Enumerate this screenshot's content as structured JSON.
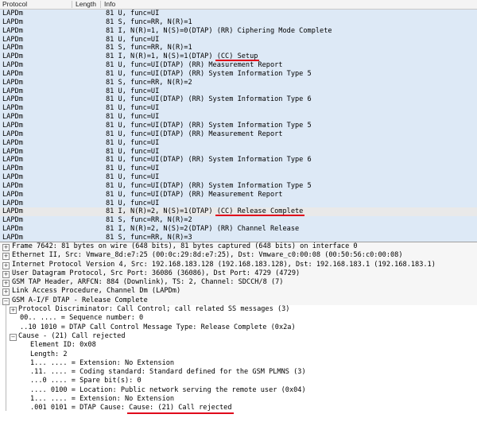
{
  "packet_list": {
    "headers": [
      "Protocol",
      "Length",
      "Info"
    ],
    "rows": [
      {
        "protocol": "LAPDm",
        "length": "",
        "info": "81 U, func=UI"
      },
      {
        "protocol": "LAPDm",
        "length": "",
        "info": "81 S, func=RR, N(R)=1"
      },
      {
        "protocol": "LAPDm",
        "length": "",
        "info": "81 I, N(R)=1, N(S)=0(DTAP) (RR) Ciphering Mode Complete"
      },
      {
        "protocol": "LAPDm",
        "length": "",
        "info": "81 U, func=UI"
      },
      {
        "protocol": "LAPDm",
        "length": "",
        "info": "81 S, func=RR, N(R)=1"
      },
      {
        "protocol": "LAPDm",
        "length": "",
        "info": "81 I, N(R)=1, N(S)=1(DTAP) (CC) Setup"
      },
      {
        "protocol": "LAPDm",
        "length": "",
        "info": "81 U, func=UI(DTAP) (RR) Measurement Report"
      },
      {
        "protocol": "LAPDm",
        "length": "",
        "info": "81 U, func=UI(DTAP) (RR) System Information Type 5"
      },
      {
        "protocol": "LAPDm",
        "length": "",
        "info": "81 S, func=RR, N(R)=2"
      },
      {
        "protocol": "LAPDm",
        "length": "",
        "info": "81 U, func=UI"
      },
      {
        "protocol": "LAPDm",
        "length": "",
        "info": "81 U, func=UI(DTAP) (RR) System Information Type 6"
      },
      {
        "protocol": "LAPDm",
        "length": "",
        "info": "81 U, func=UI"
      },
      {
        "protocol": "LAPDm",
        "length": "",
        "info": "81 U, func=UI"
      },
      {
        "protocol": "LAPDm",
        "length": "",
        "info": "81 U, func=UI(DTAP) (RR) System Information Type 5"
      },
      {
        "protocol": "LAPDm",
        "length": "",
        "info": "81 U, func=UI(DTAP) (RR) Measurement Report"
      },
      {
        "protocol": "LAPDm",
        "length": "",
        "info": "81 U, func=UI"
      },
      {
        "protocol": "LAPDm",
        "length": "",
        "info": "81 U, func=UI"
      },
      {
        "protocol": "LAPDm",
        "length": "",
        "info": "81 U, func=UI(DTAP) (RR) System Information Type 6"
      },
      {
        "protocol": "LAPDm",
        "length": "",
        "info": "81 U, func=UI"
      },
      {
        "protocol": "LAPDm",
        "length": "",
        "info": "81 U, func=UI"
      },
      {
        "protocol": "LAPDm",
        "length": "",
        "info": "81 U, func=UI(DTAP) (RR) System Information Type 5"
      },
      {
        "protocol": "LAPDm",
        "length": "",
        "info": "81 U, func=UI(DTAP) (RR) Measurement Report"
      },
      {
        "protocol": "LAPDm",
        "length": "",
        "info": "81 U, func=UI"
      },
      {
        "protocol": "LAPDm",
        "length": "",
        "info": "81 I, N(R)=2, N(S)=1(DTAP) (CC) Release Complete"
      },
      {
        "protocol": "LAPDm",
        "length": "",
        "info": "81 S, func=RR, N(R)=2"
      },
      {
        "protocol": "LAPDm",
        "length": "",
        "info": "81 I, N(R)=2, N(S)=2(DTAP) (RR) Channel Release"
      },
      {
        "protocol": "LAPDm",
        "length": "",
        "info": "81 S, func=RR, N(R)=3"
      }
    ],
    "selected_row_index": 23
  },
  "details": [
    {
      "level": 0,
      "expander": "+",
      "text": "Frame 7642: 81 bytes on wire (648 bits), 81 bytes captured (648 bits) on interface 0"
    },
    {
      "level": 0,
      "expander": "+",
      "text": "Ethernet II, Src: Vmware_8d:e7:25 (00:0c:29:8d:e7:25), Dst: Vmware_c0:00:08 (00:50:56:c0:00:08)"
    },
    {
      "level": 0,
      "expander": "+",
      "text": "Internet Protocol Version 4, Src: 192.168.183.128 (192.168.183.128), Dst: 192.168.183.1 (192.168.183.1)"
    },
    {
      "level": 0,
      "expander": "+",
      "text": "User Datagram Protocol, Src Port: 36086 (36086), Dst Port: 4729 (4729)"
    },
    {
      "level": 0,
      "expander": "+",
      "text": "GSM TAP Header, ARFCN: 884 (Downlink), TS: 2, Channel: SDCCH/8 (7)"
    },
    {
      "level": 0,
      "expander": "+",
      "text": "Link Access Procedure, Channel Dm (LAPDm)"
    },
    {
      "level": 0,
      "expander": "−",
      "text": "GSM A-I/F DTAP - Release Complete"
    },
    {
      "level": 1,
      "expander": "+",
      "text": "Protocol Discriminator: Call Control; call related SS messages (3)"
    },
    {
      "level": 1,
      "expander": "",
      "text": "00.. .... = Sequence number: 0"
    },
    {
      "level": 1,
      "expander": "",
      "text": "..10 1010 = DTAP Call Control Message Type: Release Complete (0x2a)"
    },
    {
      "level": 1,
      "expander": "−",
      "text": "Cause - (21) Call rejected"
    },
    {
      "level": 2,
      "expander": "",
      "text": "Element ID: 0x08"
    },
    {
      "level": 2,
      "expander": "",
      "text": "Length: 2"
    },
    {
      "level": 2,
      "expander": "",
      "text": "1... .... = Extension: No Extension"
    },
    {
      "level": 2,
      "expander": "",
      "text": ".11. .... = Coding standard: Standard defined for the GSM PLMNS (3)"
    },
    {
      "level": 2,
      "expander": "",
      "text": "...0 .... = Spare bit(s): 0"
    },
    {
      "level": 2,
      "expander": "",
      "text": ".... 0100 = Location: Public network serving the remote user (0x04)"
    },
    {
      "level": 2,
      "expander": "",
      "text": "1... .... = Extension: No Extension"
    },
    {
      "level": 2,
      "expander": "",
      "text": ".001 0101 = DTAP Cause: Cause: (21) Call rejected"
    }
  ],
  "colors": {
    "row_background": "#dde9f6",
    "selected_row": "#e9e9e9",
    "highlight_underline": "#e0001a"
  }
}
